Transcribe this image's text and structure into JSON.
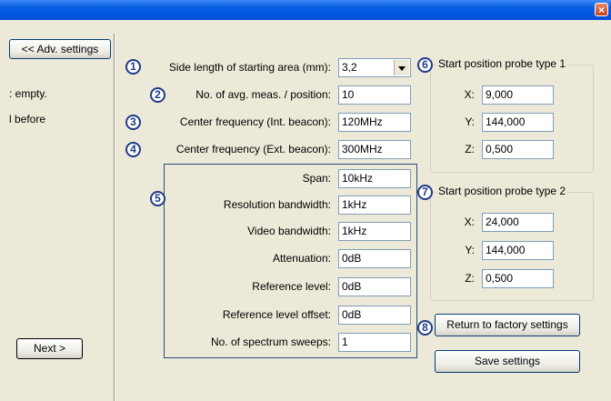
{
  "window": {
    "close_symbol": "×"
  },
  "left_panel": {
    "adv_settings_button": "<< Adv. settings",
    "text_line1": ": empty.",
    "text_line2": "l before",
    "next_button": "Next >"
  },
  "main_settings": [
    {
      "number": "1",
      "label": "Side length of starting area (mm):",
      "value": "3,2"
    },
    {
      "number": "2",
      "label": "No. of avg. meas. / position:",
      "value": "10"
    },
    {
      "number": "3",
      "label": "Center frequency (Int. beacon):",
      "value": "120MHz"
    },
    {
      "number": "4",
      "label": "Center frequency (Ext. beacon):",
      "value": "300MHz"
    }
  ],
  "spectrum_group": {
    "number": "5",
    "rows": [
      {
        "label": "Span:",
        "value": "10kHz"
      },
      {
        "label": "Resolution bandwidth:",
        "value": "1kHz"
      },
      {
        "label": "Video bandwidth:",
        "value": "1kHz"
      },
      {
        "label": "Attenuation:",
        "value": "0dB"
      },
      {
        "label": "Reference level:",
        "value": "0dB"
      },
      {
        "label": "Reference level offset:",
        "value": "0dB"
      },
      {
        "label": "No. of spectrum sweeps:",
        "value": "1"
      }
    ]
  },
  "probe1": {
    "number": "6",
    "title": "Start position probe type 1",
    "x_label": "X:",
    "x": "9,000",
    "y_label": "Y:",
    "y": "144,000",
    "z_label": "Z:",
    "z": "0,500"
  },
  "probe2": {
    "number": "7",
    "title": "Start position probe type 2",
    "x_label": "X:",
    "x": "24,000",
    "y_label": "Y:",
    "y": "144,000",
    "z_label": "Z:",
    "z": "0,500"
  },
  "factory": {
    "number": "8",
    "label": "Return to factory settings"
  },
  "save_button": "Save settings",
  "colors": {
    "titlebar": "#0055e5",
    "background": "#ece9d8",
    "badge": "#1f3c88"
  }
}
